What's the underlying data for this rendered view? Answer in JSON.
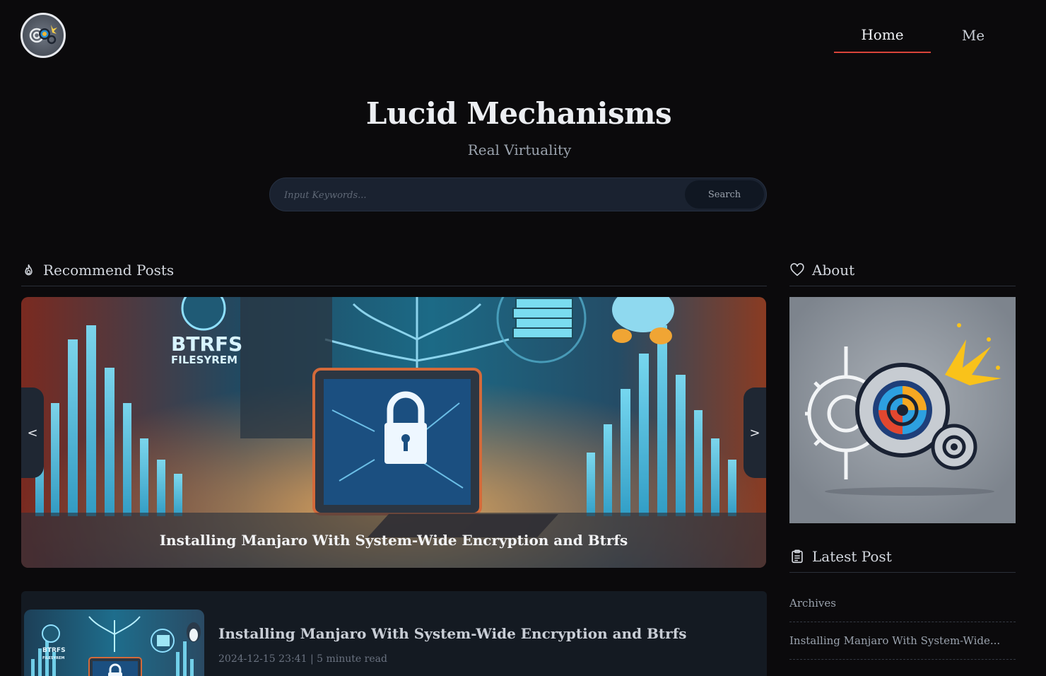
{
  "nav": {
    "items": [
      {
        "label": "Home",
        "active": true
      },
      {
        "label": "Me",
        "active": false
      }
    ]
  },
  "site": {
    "title": "Lucid Mechanisms",
    "subtitle": "Real Virtuality"
  },
  "search": {
    "placeholder": "Input Keywords...",
    "value": "",
    "button_label": "Search"
  },
  "recommend": {
    "heading": "Recommend Posts",
    "icon": "flame-icon",
    "carousel": {
      "caption": "Installing Manjaro With System-Wide Encryption and Btrfs",
      "banner_text": [
        "BTRFS",
        "FILESYREM"
      ],
      "prev_label": "<",
      "next_label": ">"
    }
  },
  "about": {
    "heading": "About",
    "icon": "heart-icon"
  },
  "latest": {
    "heading": "Latest Post",
    "icon": "clipboard-icon",
    "items": [
      {
        "label": "Archives"
      },
      {
        "label": "Installing Manjaro With System-Wide..."
      }
    ]
  },
  "posts": [
    {
      "title": "Installing Manjaro With System-Wide Encryption and Btrfs",
      "date": "2024-12-15 23:41",
      "separator": "|",
      "read_time": "5 minute read"
    }
  ],
  "colors": {
    "background": "#0b0a0c",
    "nav_active_underline": "#d9443a",
    "search_bg": "#1a2230",
    "card_bg": "#141a22"
  }
}
